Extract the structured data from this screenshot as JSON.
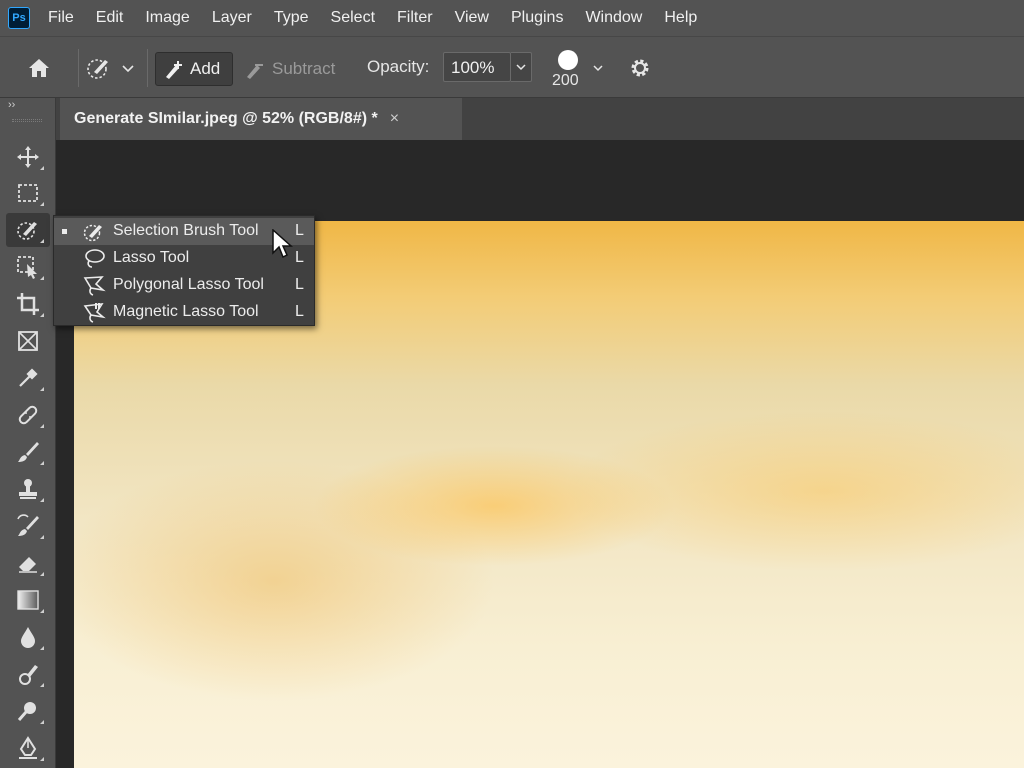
{
  "app": {
    "logo_text": "Ps"
  },
  "menu": [
    "File",
    "Edit",
    "Image",
    "Layer",
    "Type",
    "Select",
    "Filter",
    "View",
    "Plugins",
    "Window",
    "Help"
  ],
  "options_bar": {
    "add_label": "Add",
    "subtract_label": "Subtract",
    "opacity_label": "Opacity:",
    "opacity_value": "100%",
    "brush_size": "200"
  },
  "document_tab": {
    "title": "Generate SImilar.jpeg @ 52% (RGB/8#) *",
    "close": "×"
  },
  "toolbar": {
    "collapse": "››",
    "tools": [
      "move-icon",
      "marquee-icon",
      "selection-brush-icon",
      "object-selection-icon",
      "crop-icon",
      "frame-icon",
      "eyedropper-icon",
      "healing-icon",
      "brush-icon",
      "stamp-icon",
      "history-brush-icon",
      "eraser-icon",
      "gradient-icon",
      "blur-icon",
      "dodge-icon",
      "zoom-icon",
      "pen-icon"
    ]
  },
  "flyout": {
    "items": [
      {
        "label": "Selection Brush Tool",
        "key": "L",
        "icon": "selection-brush-icon",
        "selected": true
      },
      {
        "label": "Lasso Tool",
        "key": "L",
        "icon": "lasso-icon",
        "selected": false
      },
      {
        "label": "Polygonal Lasso Tool",
        "key": "L",
        "icon": "polygonal-lasso-icon",
        "selected": false
      },
      {
        "label": "Magnetic Lasso Tool",
        "key": "L",
        "icon": "magnetic-lasso-icon",
        "selected": false
      }
    ]
  },
  "colors": {
    "panel": "#535353",
    "workspace": "#282828",
    "accent": "#31a8ff"
  }
}
